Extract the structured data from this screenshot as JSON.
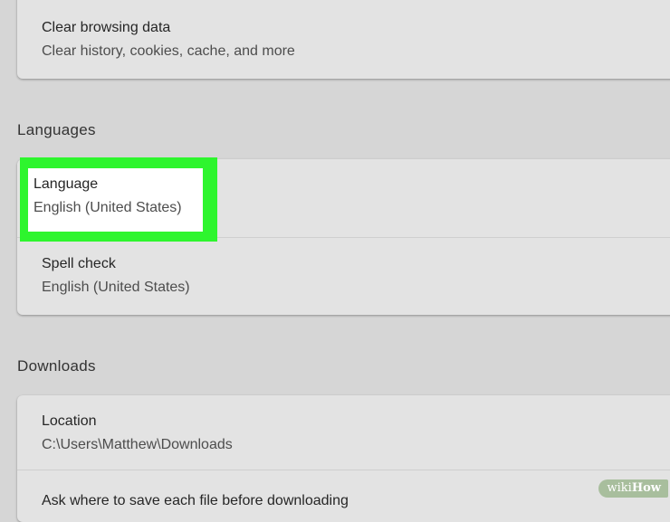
{
  "privacy": {
    "clear_browsing": {
      "title": "Clear browsing data",
      "subtitle": "Clear history, cookies, cache, and more"
    }
  },
  "languages": {
    "heading": "Languages",
    "language": {
      "title": "Language",
      "value": "English (United States)"
    },
    "spell_check": {
      "title": "Spell check",
      "value": "English (United States)"
    }
  },
  "downloads": {
    "heading": "Downloads",
    "location": {
      "title": "Location",
      "value": "C:\\Users\\Matthew\\Downloads"
    },
    "ask_where": {
      "title": "Ask where to save each file before downloading"
    }
  },
  "watermark": {
    "wiki": "wiki",
    "how": "How"
  },
  "colors": {
    "highlight": "#2ef52e",
    "page_bg": "#d6d6d6",
    "card_bg": "#e3e3e3"
  }
}
